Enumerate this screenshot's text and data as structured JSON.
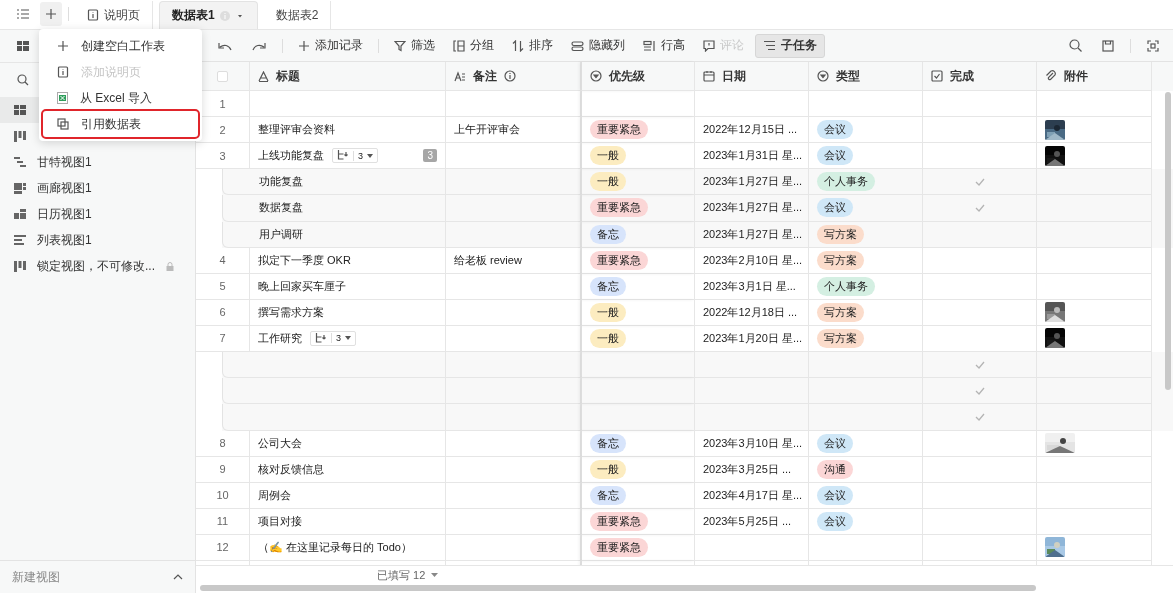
{
  "tabs": [
    {
      "label": "说明页",
      "kind": "doc",
      "selected": false
    },
    {
      "label": "数据表1",
      "kind": "sheet",
      "selected": true
    },
    {
      "label": "数据表2",
      "kind": "sheet",
      "selected": false
    }
  ],
  "add_menu": [
    {
      "label": "创建空白工作表",
      "kind": "plus",
      "disabled": false,
      "highlighted": false
    },
    {
      "label": "添加说明页",
      "kind": "doc",
      "disabled": true,
      "highlighted": false
    },
    {
      "label": "从 Excel 导入",
      "kind": "excel",
      "disabled": false,
      "highlighted": false
    },
    {
      "label": "引用数据表",
      "kind": "copy",
      "disabled": false,
      "highlighted": true
    }
  ],
  "sidebar": {
    "items": [
      {
        "kind": "grid",
        "selected": true
      },
      {
        "kind": "kanban",
        "selected": false
      },
      {
        "kind": "gantt",
        "label": "甘特视图1",
        "selected": false,
        "locked": false
      },
      {
        "kind": "gallery",
        "label": "画廊视图1",
        "selected": false,
        "locked": false
      },
      {
        "kind": "calendar",
        "label": "日历视图1",
        "selected": false,
        "locked": false
      },
      {
        "kind": "list",
        "label": "列表视图1",
        "selected": false,
        "locked": false
      },
      {
        "kind": "kanban",
        "label": "锁定视图，不可修改...",
        "selected": false,
        "locked": true
      }
    ],
    "new_view": "新建视图"
  },
  "toolbar": [
    {
      "kind": "add",
      "label": "添加记录",
      "disabled": false,
      "active": false
    },
    {
      "kind": "filter",
      "label": "筛选",
      "disabled": false,
      "active": false
    },
    {
      "kind": "group",
      "label": "分组",
      "disabled": false,
      "active": false
    },
    {
      "kind": "sort",
      "label": "排序",
      "disabled": false,
      "active": false
    },
    {
      "kind": "hide",
      "label": "隐藏列",
      "disabled": false,
      "active": false
    },
    {
      "kind": "height",
      "label": "行高",
      "disabled": false,
      "active": false
    },
    {
      "kind": "comment",
      "label": "评论",
      "disabled": true,
      "active": false
    },
    {
      "kind": "subtask",
      "label": "子任务",
      "disabled": false,
      "active": true
    }
  ],
  "table": {
    "select_all_checked": false,
    "columns": [
      {
        "kind": "text",
        "label": "标题"
      },
      {
        "kind": "longtext",
        "label": "备注",
        "info": true
      },
      {
        "kind": "select",
        "label": "优先级"
      },
      {
        "kind": "date",
        "label": "日期"
      },
      {
        "kind": "select",
        "label": "类型"
      },
      {
        "kind": "check",
        "label": "完成"
      },
      {
        "kind": "attach",
        "label": "附件"
      }
    ],
    "rows": [
      {
        "index": "1",
        "done": false
      },
      {
        "index": "2",
        "title": "整理评审会资料",
        "note": "上午开评审会",
        "priority": {
          "label": "重要紧急",
          "color": "#fbd6d6"
        },
        "date": "2022年12月15日 ...",
        "type": {
          "label": "会议",
          "color": "#cfe7f7"
        },
        "done": false,
        "attachment": {
          "kind": "picture"
        }
      },
      {
        "index": "3",
        "title": "上线功能复盘",
        "subtasks": "3",
        "badge": "3",
        "priority": {
          "label": "一般",
          "color": "#fcecc0"
        },
        "date": "2023年1月31日 星...",
        "type": {
          "label": "会议",
          "color": "#cfe7f7"
        },
        "done": false,
        "attachment": {
          "kind": "picture"
        },
        "children": [
          {
            "title": "功能复盘",
            "priority": {
              "label": "一般",
              "color": "#fcecc0"
            },
            "date": "2023年1月27日 星...",
            "type": {
              "label": "个人事务",
              "color": "#d4efe2"
            },
            "done": true
          },
          {
            "title": "数据复盘",
            "priority": {
              "label": "重要紧急",
              "color": "#fbd6d6"
            },
            "date": "2023年1月27日 星...",
            "type": {
              "label": "会议",
              "color": "#cfe7f7"
            },
            "done": true
          },
          {
            "title": "用户调研",
            "priority": {
              "label": "备忘",
              "color": "#d7e4fb"
            },
            "date": "2023年1月27日 星...",
            "type": {
              "label": "写方案",
              "color": "#fbdccb"
            },
            "done": false
          }
        ]
      },
      {
        "index": "4",
        "title": "拟定下一季度 OKR",
        "note": "给老板 review",
        "priority": {
          "label": "重要紧急",
          "color": "#fbd6d6"
        },
        "date": "2023年2月10日 星...",
        "type": {
          "label": "写方案",
          "color": "#fbdccb"
        },
        "done": false
      },
      {
        "index": "5",
        "title": "晚上回家买车厘子",
        "priority": {
          "label": "备忘",
          "color": "#d7e4fb"
        },
        "date": "2023年3月1日 星...",
        "type": {
          "label": "个人事务",
          "color": "#d4efe2"
        },
        "done": false
      },
      {
        "index": "6",
        "title": "撰写需求方案",
        "priority": {
          "label": "一般",
          "color": "#fcecc0"
        },
        "date": "2022年12月18日 ...",
        "type": {
          "label": "写方案",
          "color": "#fbdccb"
        },
        "done": false,
        "attachment": {
          "kind": "picture"
        }
      },
      {
        "index": "7",
        "title": "工作研究",
        "subtasks": "3",
        "priority": {
          "label": "一般",
          "color": "#fcecc0"
        },
        "date": "2023年1月20日 星...",
        "type": {
          "label": "写方案",
          "color": "#fbdccb"
        },
        "done": false,
        "attachment": {
          "kind": "picture"
        },
        "children": [
          {
            "done": true
          },
          {
            "done": true
          },
          {
            "done": true
          }
        ]
      },
      {
        "index": "8",
        "title": "公司大会",
        "priority": {
          "label": "备忘",
          "color": "#d7e4fb"
        },
        "date": "2023年3月10日 星...",
        "type": {
          "label": "会议",
          "color": "#cfe7f7"
        },
        "done": false,
        "attachment": {
          "kind": "picture"
        }
      },
      {
        "index": "9",
        "title": "核对反馈信息",
        "priority": {
          "label": "一般",
          "color": "#fcecc0"
        },
        "date": "2023年3月25日 ...",
        "type": {
          "label": "沟通",
          "color": "#fbd6d6"
        },
        "done": false
      },
      {
        "index": "10",
        "title": "周例会",
        "priority": {
          "label": "备忘",
          "color": "#d7e4fb"
        },
        "date": "2023年4月17日 星...",
        "type": {
          "label": "会议",
          "color": "#cfe7f7"
        },
        "done": false
      },
      {
        "index": "11",
        "title": "项目对接",
        "priority": {
          "label": "重要紧急",
          "color": "#fbd6d6"
        },
        "date": "2023年5月25日 ...",
        "type": {
          "label": "会议",
          "color": "#cfe7f7"
        },
        "done": false
      },
      {
        "index": "12",
        "title": "（✍️ 在这里记录每日的 Todo）",
        "priority": {
          "label": "重要紧急",
          "color": "#fbd6d6"
        },
        "done": false,
        "attachment": {
          "kind": "picture"
        }
      }
    ],
    "footer": "已填写 12"
  }
}
